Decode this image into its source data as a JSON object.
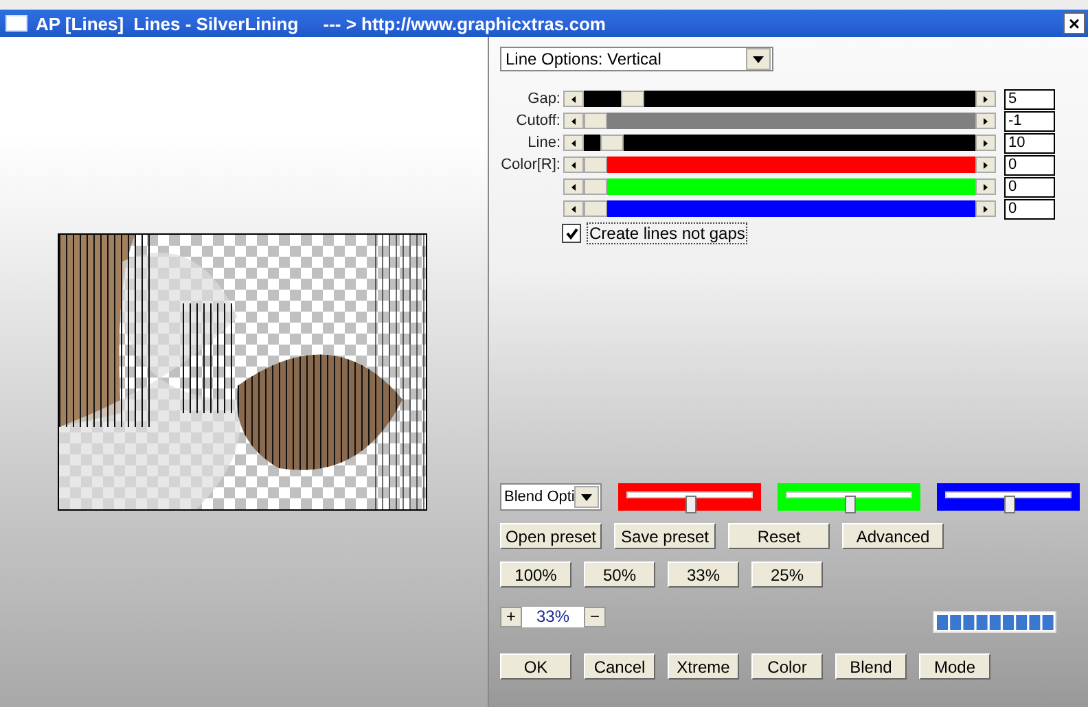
{
  "window": {
    "title": "AP [Lines]  Lines - SilverLining     --- > http://www.graphicxtras.com",
    "close": "×"
  },
  "options_dropdown": {
    "value": "Line Options: Vertical"
  },
  "sliders": [
    {
      "label": "Gap:",
      "level": 0.1,
      "value": "5",
      "color": "#000000"
    },
    {
      "label": "Cutoff:",
      "level": 0,
      "value": "-1",
      "color": "#808080"
    },
    {
      "label": "Line:",
      "level": 0.045,
      "value": "10",
      "color": "#000000"
    },
    {
      "label": "Color[R]:",
      "level": 0,
      "value": "0",
      "color": "#ff0000"
    },
    {
      "level": 0,
      "value": "0",
      "color": "#00ff00"
    },
    {
      "level": 0,
      "value": "0",
      "color": "#0000ff"
    }
  ],
  "create_lines_checkbox": {
    "label": "Create lines not gaps",
    "checked": true
  },
  "blend_dropdown": {
    "value": "Blend Opti"
  },
  "blend_sliders": [
    {
      "level": 0.5,
      "color": "#ff0000"
    },
    {
      "level": 0.5,
      "color": "#00ff00"
    },
    {
      "level": 0.5,
      "color": "#0000ff"
    }
  ],
  "preset_buttons": [
    "Open preset",
    "Save preset",
    "Reset",
    "Advanced"
  ],
  "zoom_buttons": [
    "100%",
    "50%",
    "33%",
    "25%"
  ],
  "zoom": {
    "plus": "+",
    "value": "33%",
    "minus": "−"
  },
  "bottom_buttons": [
    "OK",
    "Cancel",
    "Xtreme",
    "Color",
    "Blend",
    "Mode"
  ]
}
